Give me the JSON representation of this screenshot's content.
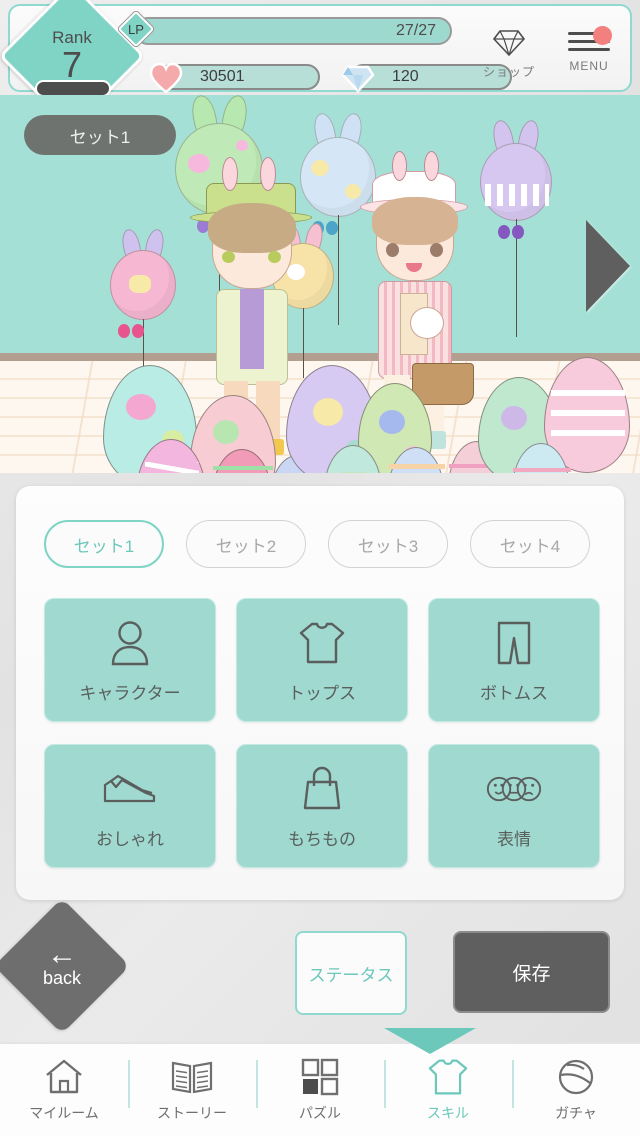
{
  "header": {
    "rank_label": "Rank",
    "rank_value": "7",
    "lp": {
      "tag": "LP",
      "value": "27/27",
      "fill_percent": 100
    },
    "currencies": [
      {
        "icon": "heart-icon",
        "value": "30501"
      },
      {
        "icon": "gem-icon",
        "value": "120"
      }
    ],
    "shop": {
      "label": "ショップ",
      "icon": "diamond-icon"
    },
    "menu": {
      "label": "MENU",
      "icon": "hamburger-icon",
      "has_notification": true
    }
  },
  "scene": {
    "set_badge": "セット1",
    "next_arrow": "arrow-right-icon"
  },
  "panel": {
    "set_tabs": [
      {
        "label": "セット1",
        "active": true
      },
      {
        "label": "セット2",
        "active": false
      },
      {
        "label": "セット3",
        "active": false
      },
      {
        "label": "セット4",
        "active": false
      }
    ],
    "categories": [
      {
        "label": "キャラクター",
        "icon": "person-icon"
      },
      {
        "label": "トップス",
        "icon": "tshirt-icon"
      },
      {
        "label": "ボトムス",
        "icon": "pants-icon"
      },
      {
        "label": "おしゃれ",
        "icon": "shoes-icon"
      },
      {
        "label": "もちもの",
        "icon": "bag-icon"
      },
      {
        "label": "表情",
        "icon": "faces-icon"
      }
    ]
  },
  "actions": {
    "back": {
      "label": "back",
      "arrow": "←"
    },
    "status": "ステータス",
    "save": "保存"
  },
  "navbar": [
    {
      "label": "マイルーム",
      "icon": "home-icon",
      "active": false
    },
    {
      "label": "ストーリー",
      "icon": "book-icon",
      "active": false
    },
    {
      "label": "パズル",
      "icon": "grid-icon",
      "active": false
    },
    {
      "label": "スキル",
      "icon": "tshirt-icon",
      "active": true
    },
    {
      "label": "ガチャ",
      "icon": "gacha-ball-icon",
      "active": false
    }
  ],
  "colors": {
    "accent_teal": "#7fd4c6",
    "wall_teal": "#a5e0d6",
    "panel_bg": "#fdfdfd",
    "dark_gray": "#5f5f5f",
    "notification_pink": "#f2807e",
    "heart_pink": "#f4a9ab"
  }
}
